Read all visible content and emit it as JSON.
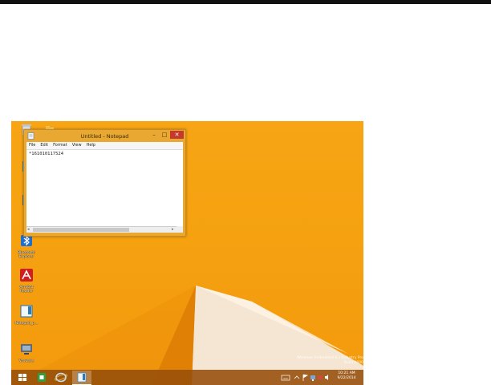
{
  "notepad": {
    "title": "Untitled - Notepad",
    "menu": [
      "File",
      "Edit",
      "Format",
      "View",
      "Help"
    ],
    "content": "*161010117524",
    "controls": {
      "minimize": "–",
      "maximize": "□",
      "close": "✕"
    }
  },
  "desktop": {
    "icons": [
      {
        "label": "Bluetooth Explorer",
        "icon": "bluetooth-icon"
      },
      {
        "label": "Acrobat Reader",
        "icon": "acrobat-icon"
      },
      {
        "label": "Notepad_p...",
        "icon": "notepad-icon"
      },
      {
        "label": "Vmware",
        "icon": "vmware-icon"
      }
    ]
  },
  "taskbar": {
    "clock": {
      "time": "10:21 AM",
      "date": "9/22/2014"
    },
    "apps": [
      "start-icon",
      "store-icon",
      "ie-icon",
      "notepad-icon"
    ]
  },
  "watermark": {
    "line1": "Windows Embedded 8.1 Industry Pro",
    "line2": "Build 9600"
  },
  "colors": {
    "wallpaper": "#f5a110",
    "taskbar": "#964e0a",
    "close": "#c7382c"
  }
}
